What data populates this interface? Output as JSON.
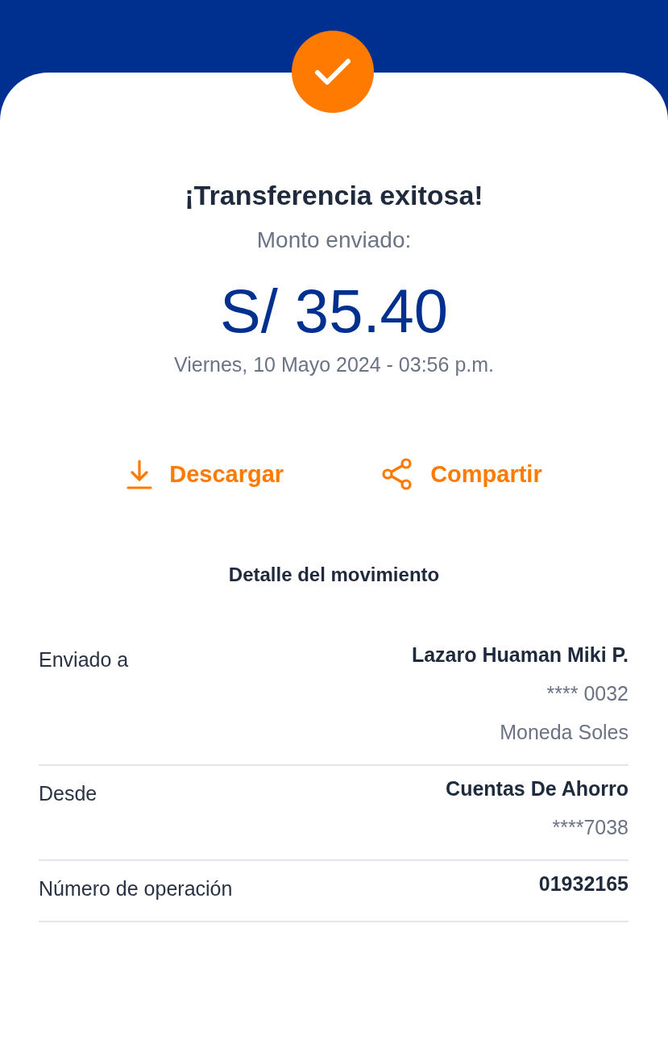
{
  "title": "¡Transferencia exitosa!",
  "amount_label": "Monto enviado:",
  "amount": "S/ 35.40",
  "datetime": "Viernes, 10 Mayo 2024 - 03:56 p.m.",
  "actions": [
    {
      "label": "Descargar",
      "kind": "download"
    },
    {
      "label": "Compartir",
      "kind": "share"
    }
  ],
  "detail_title": "Detalle del movimiento",
  "details": [
    {
      "label": "Enviado a",
      "values": [
        {
          "text": "Lazaro Huaman Miki P.",
          "kind": "primary"
        },
        {
          "text": "**** 0032",
          "kind": "secondary"
        },
        {
          "text": "Moneda Soles",
          "kind": "secondary"
        }
      ]
    },
    {
      "label": "Desde",
      "values": [
        {
          "text": "Cuentas De Ahorro",
          "kind": "primary"
        },
        {
          "text": "****7038",
          "kind": "secondary"
        }
      ]
    },
    {
      "label": "Número de operación",
      "values": [
        {
          "text": "01932165",
          "kind": "strong"
        }
      ]
    }
  ]
}
